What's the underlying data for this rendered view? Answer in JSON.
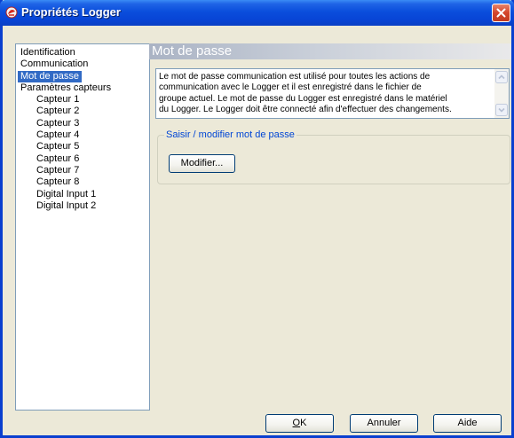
{
  "window": {
    "title": "Propriétés Logger"
  },
  "tree": {
    "items": [
      {
        "label": "Identification",
        "level": 0,
        "selected": false
      },
      {
        "label": "Communication",
        "level": 0,
        "selected": false
      },
      {
        "label": "Mot de passe",
        "level": 0,
        "selected": true
      },
      {
        "label": "Paramètres capteurs",
        "level": 0,
        "selected": false
      },
      {
        "label": "Capteur 1",
        "level": 1,
        "selected": false
      },
      {
        "label": "Capteur 2",
        "level": 1,
        "selected": false
      },
      {
        "label": "Capteur 3",
        "level": 1,
        "selected": false
      },
      {
        "label": "Capteur 4",
        "level": 1,
        "selected": false
      },
      {
        "label": "Capteur 5",
        "level": 1,
        "selected": false
      },
      {
        "label": "Capteur 6",
        "level": 1,
        "selected": false
      },
      {
        "label": "Capteur 7",
        "level": 1,
        "selected": false
      },
      {
        "label": "Capteur 8",
        "level": 1,
        "selected": false
      },
      {
        "label": "Digital Input 1",
        "level": 1,
        "selected": false
      },
      {
        "label": "Digital Input 2",
        "level": 1,
        "selected": false
      }
    ]
  },
  "main": {
    "section_title": "Mot de passe",
    "description_lines": [
      "Le mot de passe communication est utilisé pour toutes les actions de",
      "communication avec le Logger et il est enregistré dans le fichier de",
      "groupe actuel. Le mot de passe du Logger est enregistré dans le matériel",
      "du Logger. Le Logger doit être connecté afin d'effectuer des changements."
    ],
    "group_label": "Saisir / modifier mot de passe",
    "modify_button": "Modifier..."
  },
  "footer": {
    "ok_mnemonic": "O",
    "ok_rest": "K",
    "cancel_label": "Annuler",
    "help_label": "Aide"
  },
  "colors": {
    "titlebar": "#0a4edc",
    "selection": "#316ac5",
    "group_label": "#0046d5",
    "dialog_bg": "#ece9d8"
  }
}
